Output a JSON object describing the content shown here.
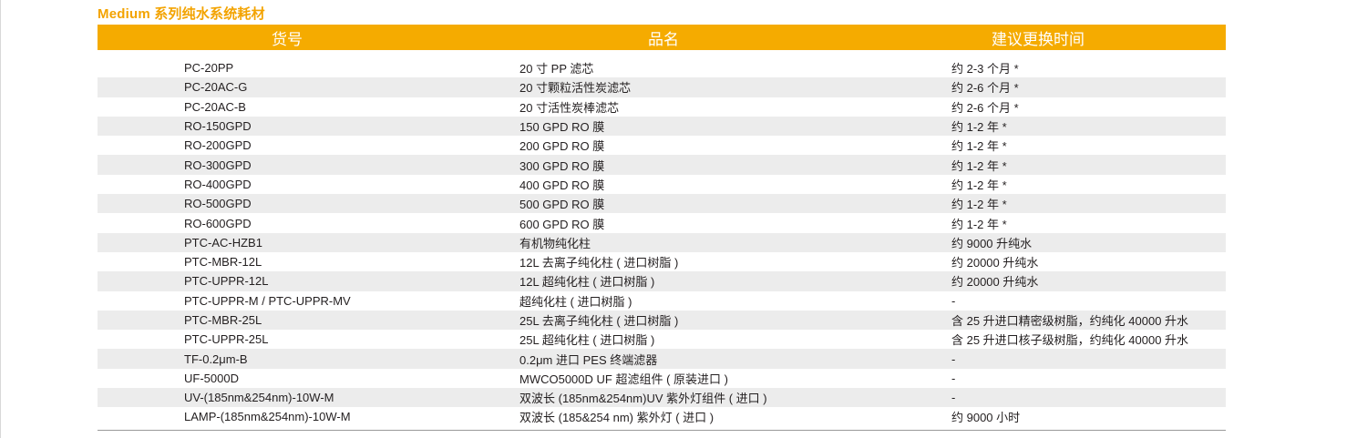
{
  "section_title": "Medium 系列纯水系统耗材",
  "table": {
    "headers": [
      "货号",
      "品名",
      "建议更换时间"
    ],
    "rows": [
      [
        "PC-20PP",
        "20 寸 PP 滤芯",
        "约 2-3 个月 *"
      ],
      [
        "PC-20AC-G",
        "20 寸颗粒活性炭滤芯",
        "约 2-6 个月 *"
      ],
      [
        "PC-20AC-B",
        "20 寸活性炭棒滤芯",
        "约 2-6 个月 *"
      ],
      [
        "RO-150GPD",
        "150 GPD RO 膜",
        "约 1-2 年 *"
      ],
      [
        "RO-200GPD",
        "200 GPD RO 膜",
        "约 1-2 年 *"
      ],
      [
        "RO-300GPD",
        "300 GPD RO 膜",
        "约 1-2 年 *"
      ],
      [
        "RO-400GPD",
        "400 GPD RO 膜",
        "约 1-2 年 *"
      ],
      [
        "RO-500GPD",
        "500 GPD RO 膜",
        "约 1-2 年 *"
      ],
      [
        "RO-600GPD",
        "600 GPD RO 膜",
        "约 1-2 年 *"
      ],
      [
        "PTC-AC-HZB1",
        "有机物纯化柱",
        "约 9000 升纯水"
      ],
      [
        "PTC-MBR-12L",
        "12L 去离子纯化柱 ( 进口树脂 )",
        "约 20000 升纯水"
      ],
      [
        "PTC-UPPR-12L",
        "12L 超纯化柱 ( 进口树脂 )",
        "约 20000 升纯水"
      ],
      [
        "PTC-UPPR-M / PTC-UPPR-MV",
        "超纯化柱 ( 进口树脂 )",
        "-"
      ],
      [
        "PTC-MBR-25L",
        "25L 去离子纯化柱 ( 进口树脂 )",
        "含 25 升进口精密级树脂，约纯化 40000 升水"
      ],
      [
        "PTC-UPPR-25L",
        "25L 超纯化柱 ( 进口树脂 )",
        "含 25 升进口核子级树脂，约纯化 40000 升水"
      ],
      [
        "TF-0.2μm-B",
        "0.2μm 进口 PES 终端滤器",
        "-"
      ],
      [
        "UF-5000D",
        "MWCO5000D UF 超滤组件 ( 原装进口 )",
        "-"
      ],
      [
        "UV-(185nm&254nm)-10W-M",
        "双波长 (185nm&254nm)UV 紫外灯组件 ( 进口 )",
        "-"
      ],
      [
        "LAMP-(185nm&254nm)-10W-M",
        "双波长 (185&254 nm) 紫外灯 ( 进口 )",
        "约 9000 小时"
      ]
    ]
  },
  "colors": {
    "accent": "#f5ab00",
    "title": "#f3a300",
    "row_shade": "#ececec"
  }
}
